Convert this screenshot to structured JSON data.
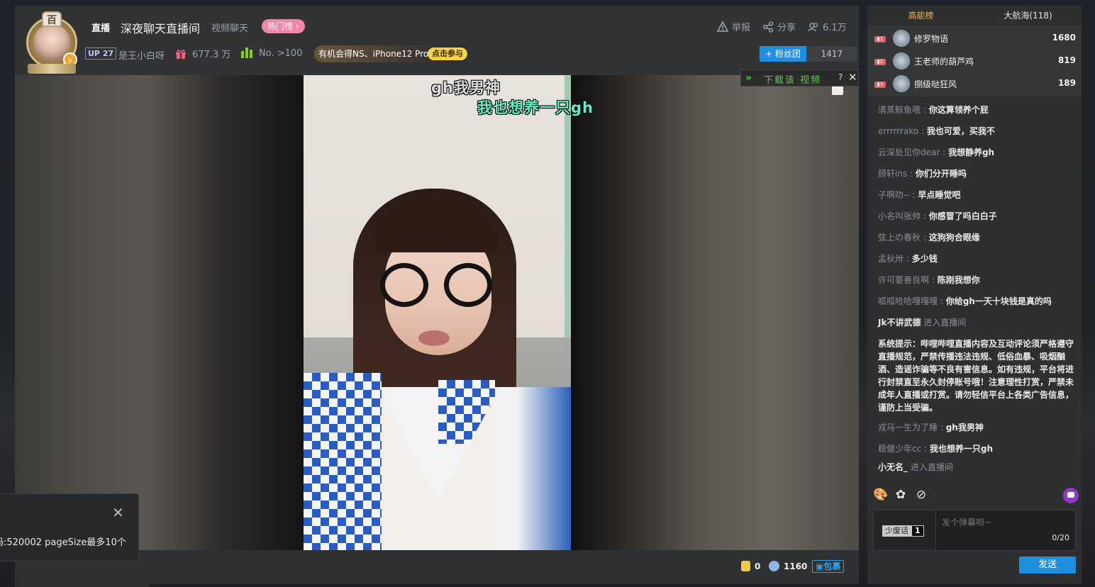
{
  "header": {
    "live_tag": "直播",
    "room_title": "深夜聊天直播间",
    "category": "视频聊天",
    "hot_badge": "热门榜 ›",
    "report": "举报",
    "share": "分享",
    "viewers": "6.1万",
    "up_level": "UP 27",
    "streamer_name": "是王小白呀",
    "gift_count": "677.3 万",
    "rank": "No. >100",
    "promo_text": "有机会得NS、iPhone12 Pro",
    "promo_button": "点击参与",
    "fan_button": "+ 粉丝团",
    "fan_count": "1417",
    "avatar_badge": "百"
  },
  "video": {
    "danmaku": [
      {
        "text": "gh我男神",
        "color": "#ffffff"
      },
      {
        "text": "我也想养一只gh",
        "color": "#5ff0c8"
      }
    ],
    "download_bar": {
      "text": "下载该 视频",
      "help": "?",
      "close": "✕"
    }
  },
  "bottom": {
    "gold_coins": "0",
    "silver_coins": "1160",
    "package_label": "包裹"
  },
  "toast": {
    "message": "码:520002 pageSize最多10个",
    "close": "✕"
  },
  "sidebar": {
    "tabs": [
      {
        "label": "高能榜",
        "active": true
      },
      {
        "label": "大航海(118)",
        "active": false
      }
    ],
    "rank_list": [
      {
        "name": "修罗物语",
        "score": "1680"
      },
      {
        "name": "王老师的葫芦鸡",
        "score": "819"
      },
      {
        "name": "捌级哒狂风",
        "score": "189"
      }
    ],
    "messages": [
      {
        "user": "清蒸鲸鱼哦",
        "text": "你这算领养个屁"
      },
      {
        "user": "errrrrrako",
        "text": "我也可爱，买我不"
      },
      {
        "user": "云深处见你dear",
        "text": "我想静养gh"
      },
      {
        "user": "顾轩ins",
        "text": "你们分开睡吗"
      },
      {
        "user": "子啊叻--",
        "text": "早点睡觉吧"
      },
      {
        "user": "小名叫张帅",
        "text": "你感冒了吗白白子"
      },
      {
        "user": "弦上の春秋",
        "text": "这狗狗合眼缘"
      },
      {
        "user": "孟秋卅",
        "text": "多少钱"
      },
      {
        "user": "许可要善良啊",
        "text": "陈刚我想你"
      },
      {
        "user": "呱呱哈哈嘎嘎嘎",
        "text": "你给gh一天十块钱是真的吗"
      }
    ],
    "enter_1": {
      "user": "Jk不讲武德",
      "text": "进入直播间"
    },
    "system": {
      "prefix": "系统提示：",
      "body": "哔哩哔哩直播内容及互动评论须严格遵守直播规范，严禁传播违法违规、低俗血暴、吸烟酗酒、造谣诈骗等不良有害信息。如有违规，平台将进行封禁直至永久封停账号哦！注意理性打赏，严禁未成年人直播或打赏。请勿轻信平台上各类广告信息，谨防上当受骗。"
    },
    "messages2": [
      {
        "user": "戎马一生为了睡",
        "text": "gh我男神"
      },
      {
        "user": "稳健少年cc",
        "text": "我也想养一只gh"
      }
    ],
    "enter_2": {
      "user": "小无名_",
      "text": "进入直播间"
    },
    "input": {
      "mode_label": "少废话",
      "mode_num": "1",
      "placeholder": "发个弹幕呗~",
      "char_count": "0/20",
      "send": "发送"
    }
  }
}
